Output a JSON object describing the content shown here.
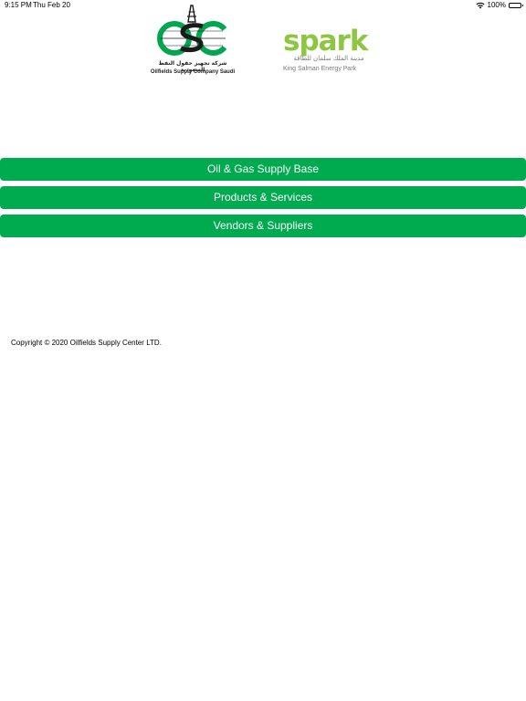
{
  "status_bar": {
    "time": "9:15 PM",
    "date": "Thu Feb 20",
    "wifi_icon": "wifi-icon",
    "battery": "100%",
    "battery_icon": "battery-icon"
  },
  "logos": {
    "osc": {
      "arabic": "شركة تجهيز حقول النفط السعودية",
      "english": "Oilfields Supply Company Saudi",
      "colors": {
        "green": "#00a650",
        "dark": "#1a1a1a"
      }
    },
    "spark": {
      "word": "spark",
      "arabic": "مدينة الملك سلمان للطاقة",
      "english": "King Salman Energy Park",
      "color": "#8dc63f"
    }
  },
  "menu": {
    "items": [
      {
        "label": "Oil & Gas Supply Base"
      },
      {
        "label": "Products & Services"
      },
      {
        "label": "Vendors & Suppliers"
      }
    ],
    "button_color": "#00aa4f"
  },
  "footer": {
    "copyright": "Copyright © 2020 Oilfields Supply Center LTD."
  }
}
